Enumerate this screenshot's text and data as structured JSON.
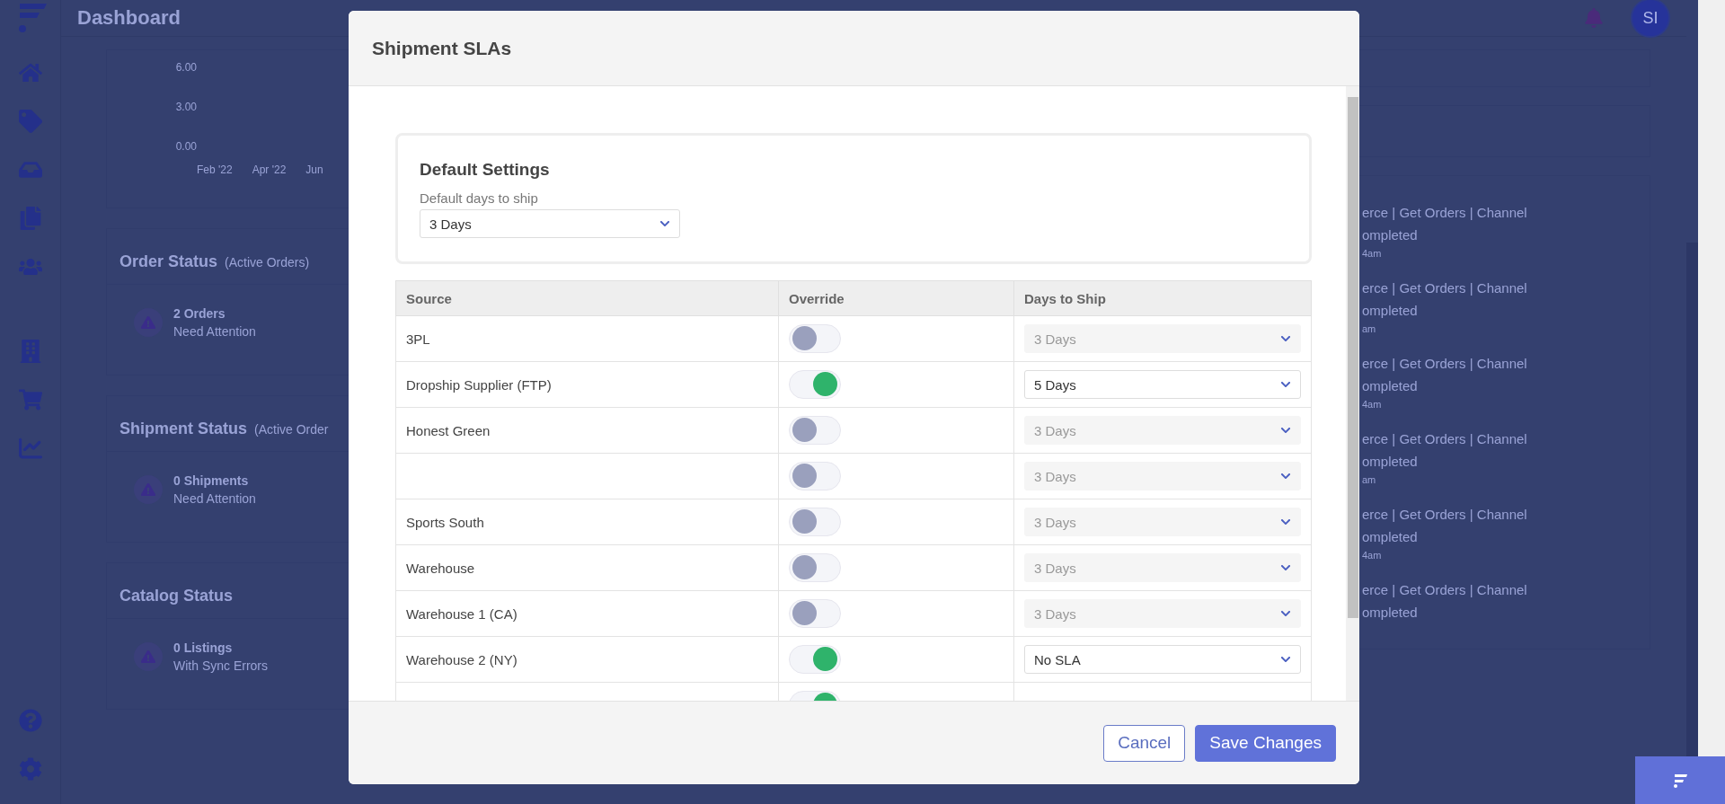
{
  "page": {
    "title": "Dashboard",
    "avatar": "SI"
  },
  "chart": {
    "y_ticks": [
      "6.00",
      "3.00",
      "0.00"
    ],
    "x_labels": [
      "Feb '22",
      "Apr '22",
      "Jun"
    ]
  },
  "status_cards": [
    {
      "title": "Order Status",
      "subtitle": "(Active Orders)",
      "count": "2 Orders",
      "note": "Need Attention"
    },
    {
      "title": "Shipment Status",
      "subtitle": "(Active Order",
      "count": "0 Shipments",
      "note": "Need Attention"
    },
    {
      "title": "Catalog Status",
      "count": "0 Listings",
      "note": "With Sync Errors"
    }
  ],
  "activity": [
    {
      "text": "erce | Get Orders | Channel",
      "status": "ompleted",
      "time": "4am"
    },
    {
      "text": "erce | Get Orders | Channel",
      "status": "ompleted",
      "time": "am"
    },
    {
      "text": "erce | Get Orders | Channel",
      "status": "ompleted",
      "time": "4am"
    },
    {
      "text": "erce | Get Orders | Channel",
      "status": "ompleted",
      "time": "am"
    },
    {
      "text": "erce | Get Orders | Channel",
      "status": "ompleted",
      "time": "4am"
    },
    {
      "text": "erce | Get Orders | Channel",
      "status": "ompleted"
    }
  ],
  "modal": {
    "title": "Shipment SLAs",
    "defaults": {
      "title": "Default Settings",
      "label": "Default days to ship",
      "value": "3 Days"
    },
    "columns": [
      "Source",
      "Override",
      "Days to Ship"
    ],
    "rows": [
      {
        "source": "3PL",
        "on": false,
        "days": "3 Days"
      },
      {
        "source": "Dropship Supplier (FTP)",
        "on": true,
        "days": "5 Days"
      },
      {
        "source": "Honest Green",
        "on": false,
        "days": "3 Days"
      },
      {
        "on": false,
        "days": "3 Days"
      },
      {
        "source": "Sports South",
        "on": false,
        "days": "3 Days"
      },
      {
        "source": "Warehouse",
        "on": false,
        "days": "3 Days"
      },
      {
        "source": "Warehouse 1 (CA)",
        "on": false,
        "days": "3 Days"
      },
      {
        "source": "Warehouse 2 (NY)",
        "on": true,
        "days": "No SLA"
      },
      {
        "on": true
      }
    ],
    "buttons": [
      {
        "label": "Cancel",
        "kind": "secondary"
      },
      {
        "label": "Save Changes",
        "kind": "primary"
      }
    ]
  }
}
